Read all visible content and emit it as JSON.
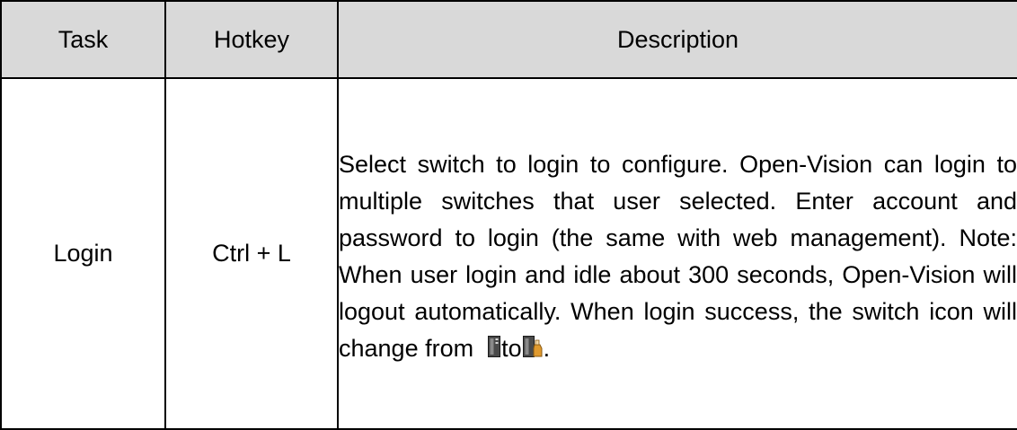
{
  "table": {
    "headers": {
      "task": "Task",
      "hotkey": "Hotkey",
      "description": "Description"
    },
    "rows": [
      {
        "task": "Login",
        "hotkey": "Ctrl + L",
        "description_main": "Select switch to login to configure. Open-Vision can login to multiple switches that user selected. Enter account and password to login (the same with web management). Note: When user login and idle about 300 seconds, Open-Vision will logout automatically. When login success, the switch icon will change from",
        "description_joiner": "to",
        "description_end": "."
      }
    ]
  },
  "icons": {
    "from": "switch-logged-out-icon",
    "to": "switch-logged-in-icon"
  },
  "colors": {
    "header_background": "#d9d9d9",
    "border": "#000000"
  }
}
